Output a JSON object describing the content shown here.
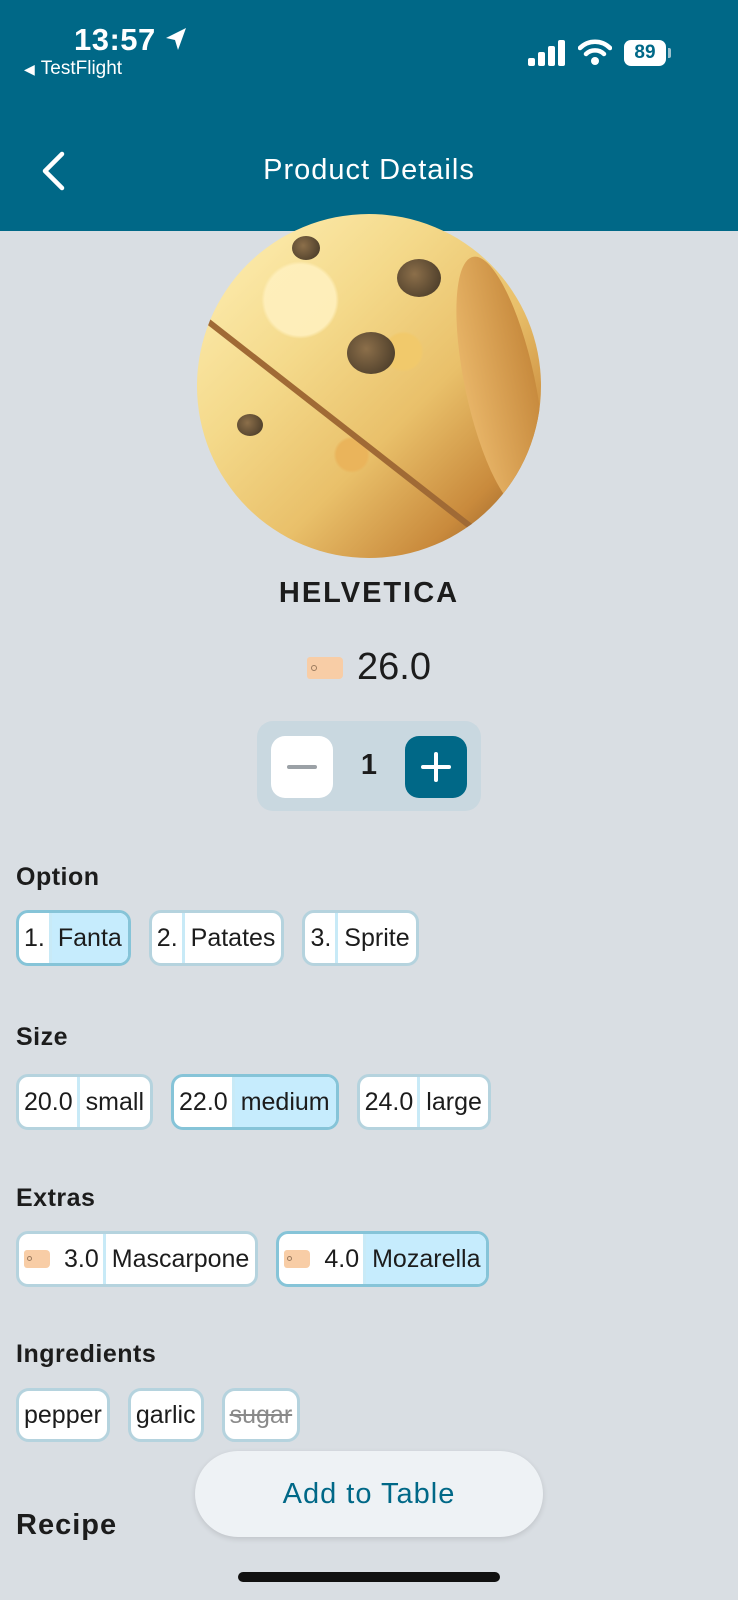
{
  "status_bar": {
    "time": "13:57",
    "back_app": "TestFlight",
    "battery": "89"
  },
  "nav": {
    "title": "Product Details"
  },
  "product": {
    "name": "HELVETICA",
    "price": "26.0",
    "quantity": "1"
  },
  "options": {
    "label": "Option",
    "items": [
      {
        "index": "1.",
        "name": "Fanta",
        "selected": true
      },
      {
        "index": "2.",
        "name": "Patates",
        "selected": false
      },
      {
        "index": "3.",
        "name": "Sprite",
        "selected": false
      }
    ]
  },
  "size": {
    "label": "Size",
    "items": [
      {
        "price": "20.0",
        "name": "small",
        "selected": false
      },
      {
        "price": "22.0",
        "name": "medium",
        "selected": true
      },
      {
        "price": "24.0",
        "name": "large",
        "selected": false
      }
    ]
  },
  "extras": {
    "label": "Extras",
    "items": [
      {
        "price": "3.0",
        "name": "Mascarpone",
        "selected": false
      },
      {
        "price": "4.0",
        "name": "Mozarella",
        "selected": true
      }
    ]
  },
  "ingredients": {
    "label": "Ingredients",
    "items": [
      {
        "name": "pepper",
        "removed": false
      },
      {
        "name": "garlic",
        "removed": false
      },
      {
        "name": "sugar",
        "removed": true
      }
    ]
  },
  "recipe_label": "Recipe",
  "cta_label": "Add to Table",
  "colors": {
    "brand": "#006887",
    "background": "#d9dee3",
    "selected_fill": "#c6ecfd",
    "chip_border": "#b5d3de"
  }
}
